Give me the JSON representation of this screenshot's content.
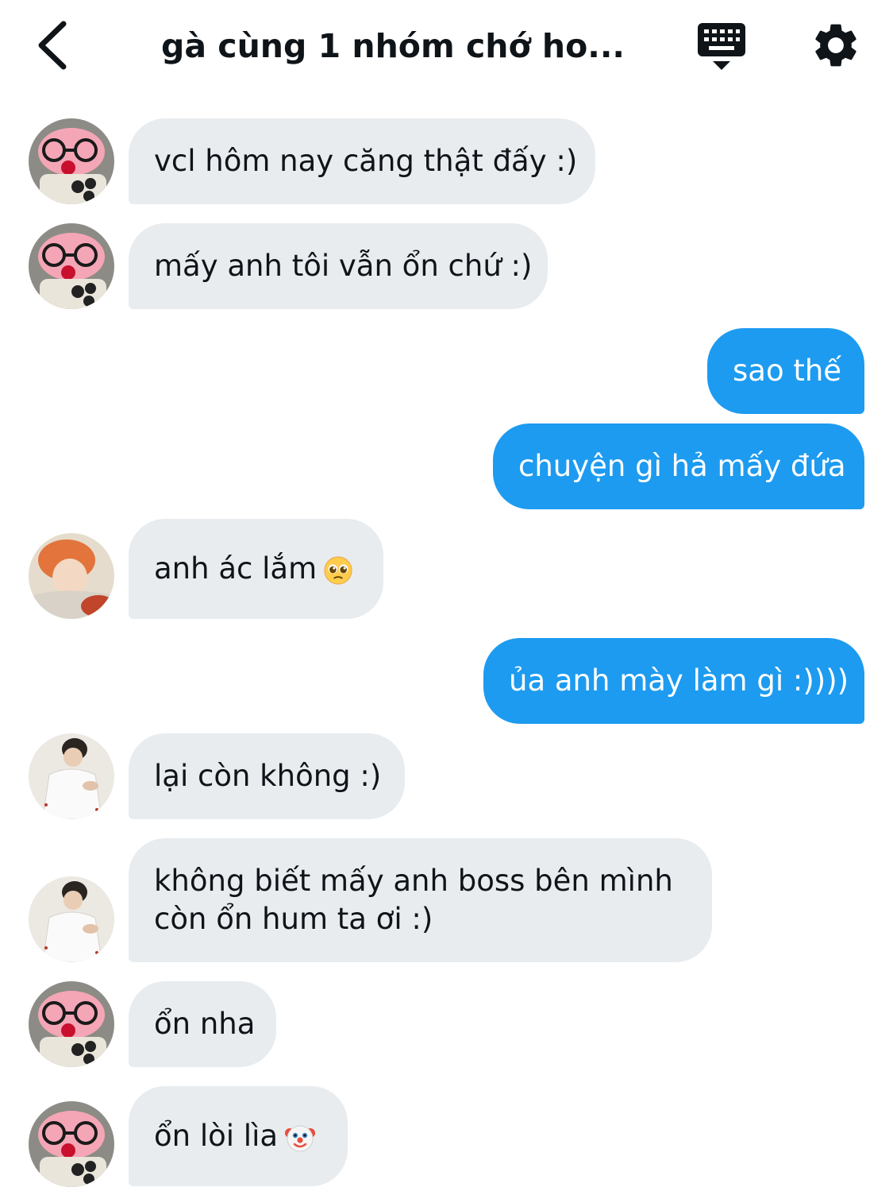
{
  "header": {
    "title": "gà cùng 1 nhóm chớ ho...",
    "icons": {
      "back": "chevron-left-icon",
      "keyboard": "keyboard-icon",
      "settings": "gear-icon"
    }
  },
  "colors": {
    "outgoing": "#1d9bf0",
    "incoming": "#e8ecef",
    "text": "#0f1419"
  },
  "messages": [
    {
      "dir": "in",
      "avatar": "pig",
      "text": "vcl hôm nay căng thật đấy :)"
    },
    {
      "dir": "in",
      "avatar": "pig",
      "text": "mấy anh tôi vẫn ổn chứ :)"
    },
    {
      "dir": "out",
      "text": "sao thế"
    },
    {
      "dir": "out",
      "text": "chuyện gì hả mấy đứa"
    },
    {
      "dir": "in",
      "avatar": "orange-hair",
      "text": "anh ác lắm",
      "emoji": "pleading-face"
    },
    {
      "dir": "out",
      "text": "ủa anh mày làm gì :))))"
    },
    {
      "dir": "in",
      "avatar": "boy-white",
      "text": "lại còn không :)"
    },
    {
      "dir": "in",
      "avatar": "boy-white",
      "lines": [
        "không biết mấy anh boss bên mình",
        "còn ổn hum ta ơi :)"
      ]
    },
    {
      "dir": "in",
      "avatar": "pig",
      "text": "ổn nha"
    },
    {
      "dir": "in",
      "avatar": "pig",
      "text": "ổn lòi lìa",
      "emoji": "clown-face"
    }
  ]
}
